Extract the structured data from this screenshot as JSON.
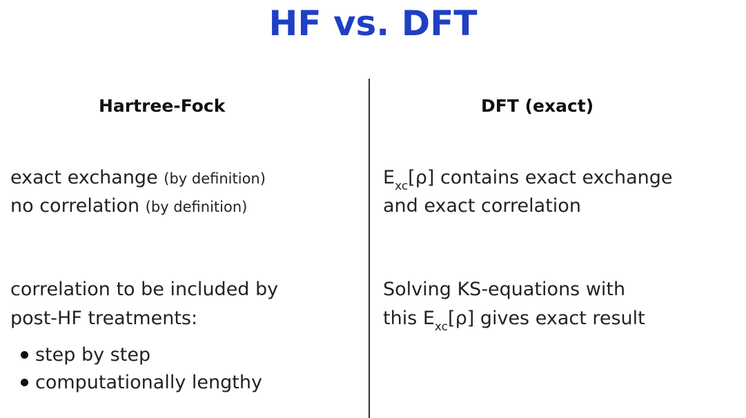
{
  "title": "HF vs. DFT",
  "left": {
    "heading": "Hartree-Fock",
    "line1_main": "exact exchange ",
    "line1_note": "(by definition)",
    "line2_main": "no correlation ",
    "line2_note": "(by definition)",
    "line3": "correlation to be included by",
    "line4": "post-HF treatments:",
    "bullets": [
      "step by step",
      "computationally lengthy"
    ]
  },
  "right": {
    "heading": "DFT (exact)",
    "line1_prefix": "E",
    "line1_sub": "xc",
    "line1_suffix": "[ρ] contains exact exchange",
    "line2": "and exact correlation",
    "line3": "Solving KS-equations with",
    "line4_prefix": "this E",
    "line4_sub": "xc",
    "line4_suffix": "[ρ] gives exact result"
  }
}
